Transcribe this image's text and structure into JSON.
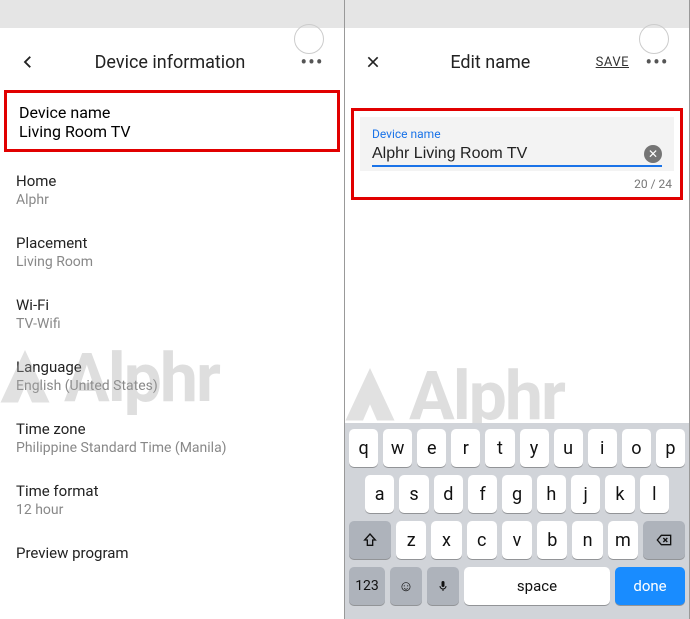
{
  "left": {
    "header_title": "Device information",
    "rows": {
      "device_name": {
        "label": "Device name",
        "value": "Living Room TV"
      },
      "home": {
        "label": "Home",
        "value": "Alphr"
      },
      "placement": {
        "label": "Placement",
        "value": "Living Room"
      },
      "wifi": {
        "label": "Wi-Fi",
        "value": "TV-Wifi"
      },
      "language": {
        "label": "Language",
        "value": "English (United States)"
      },
      "timezone": {
        "label": "Time zone",
        "value": "Philippine Standard Time (Manila)"
      },
      "timeformat": {
        "label": "Time format",
        "value": "12 hour"
      },
      "preview": {
        "label": "Preview program"
      }
    }
  },
  "right": {
    "header_title": "Edit name",
    "save_label": "SAVE",
    "field_label": "Device name",
    "field_value": "Alphr Living Room TV",
    "counter": "20 / 24",
    "keyboard": {
      "row1": [
        "q",
        "w",
        "e",
        "r",
        "t",
        "y",
        "u",
        "i",
        "o",
        "p"
      ],
      "row2": [
        "a",
        "s",
        "d",
        "f",
        "g",
        "h",
        "j",
        "k",
        "l"
      ],
      "row3": [
        "z",
        "x",
        "c",
        "v",
        "b",
        "n",
        "m"
      ],
      "sym": "123",
      "space": "space",
      "done": "done"
    }
  },
  "watermark": "Alphr"
}
